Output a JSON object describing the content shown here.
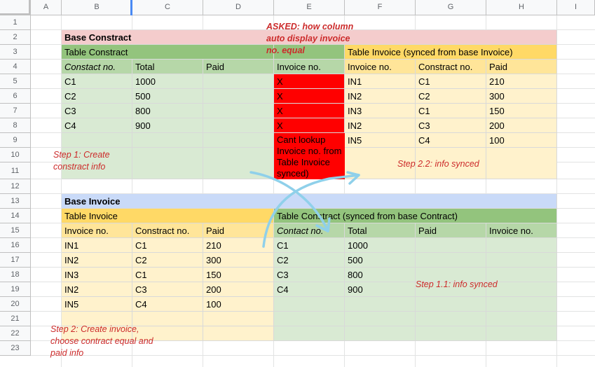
{
  "columns": [
    "A",
    "B",
    "C",
    "D",
    "E",
    "F",
    "G",
    "H",
    "I"
  ],
  "rows": [
    "1",
    "2",
    "3",
    "4",
    "5",
    "6",
    "7",
    "8",
    "9",
    "10",
    "11",
    "12",
    "13",
    "14",
    "15",
    "16",
    "17",
    "18",
    "19",
    "20",
    "21",
    "22",
    "23"
  ],
  "colors": {
    "pink": "#f4cccc",
    "green_dark": "#93c47d",
    "green_mid": "#b6d7a8",
    "green_light": "#d9ead3",
    "orange_dark": "#ffd966",
    "orange_mid": "#ffe599",
    "orange_light": "#fff2cc",
    "blue": "#c9daf8",
    "red": "#ff0000",
    "note_red": "#cc2b2b",
    "arrow": "#8fd0ea"
  },
  "base_contract": {
    "title": "Base Constract",
    "table_contract_title": "Table Constract",
    "table_invoice_title": "Table Invoice (synced from base Invoice)",
    "contract_headers": [
      "Constact no.",
      "Total",
      "Paid"
    ],
    "invoice_lookup_header": "Invoice no.",
    "contract_rows": [
      [
        "C1",
        "1000",
        ""
      ],
      [
        "C2",
        "500",
        ""
      ],
      [
        "C3",
        "800",
        ""
      ],
      [
        "C4",
        "900",
        ""
      ]
    ],
    "invoice_lookup_values": [
      "X",
      "X",
      "X",
      "X"
    ],
    "lookup_error_note": "Cant lookup Invoice no. from Table Invoice synced)",
    "invoice_headers": [
      "Invoice no.",
      "Constract no.",
      "Paid"
    ],
    "invoice_rows": [
      [
        "IN1",
        "C1",
        "210"
      ],
      [
        "IN2",
        "C2",
        "300"
      ],
      [
        "IN3",
        "C1",
        "150"
      ],
      [
        "IN2",
        "C3",
        "200"
      ],
      [
        "IN5",
        "C4",
        "100"
      ]
    ]
  },
  "base_invoice": {
    "title": "Base Invoice",
    "table_invoice_title": "Table Invoice",
    "table_contract_title": "Table Constract (synced from base Contract)",
    "invoice_headers": [
      "Invoice no.",
      "Constract no.",
      "Paid"
    ],
    "invoice_rows": [
      [
        "IN1",
        "C1",
        "210"
      ],
      [
        "IN2",
        "C2",
        "300"
      ],
      [
        "IN3",
        "C1",
        "150"
      ],
      [
        "IN2",
        "C3",
        "200"
      ],
      [
        "IN5",
        "C4",
        "100"
      ]
    ],
    "contract_headers": [
      "Contact no.",
      "Total",
      "Paid",
      "Invoice no."
    ],
    "contract_rows": [
      [
        "C1",
        "1000",
        "",
        ""
      ],
      [
        "C2",
        "500",
        "",
        ""
      ],
      [
        "C3",
        "800",
        "",
        ""
      ],
      [
        "C4",
        "900",
        "",
        ""
      ]
    ]
  },
  "notes": {
    "asked": "ASKED: how column auto display invoice no. equal",
    "step1": "Step 1: Create constract info",
    "step11": "Step 1.1: info synced",
    "step2": "Step 2: Create invoice, choose contract equal and paid info",
    "step22": "Step 2.2: info synced"
  }
}
